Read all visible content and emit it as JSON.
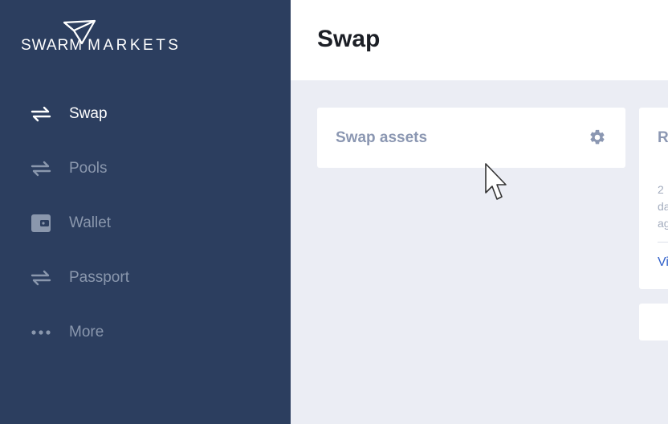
{
  "logo": {
    "word1": "SWARM",
    "word2": "MARKETS"
  },
  "nav": {
    "items": [
      {
        "label": "Swap",
        "icon": "swap-arrows-icon",
        "active": true
      },
      {
        "label": "Pools",
        "icon": "swap-arrows-icon",
        "active": false
      },
      {
        "label": "Wallet",
        "icon": "wallet-icon",
        "active": false
      },
      {
        "label": "Passport",
        "icon": "swap-arrows-icon",
        "active": false
      },
      {
        "label": "More",
        "icon": "more-dots-icon",
        "active": false
      }
    ]
  },
  "header": {
    "title": "Swap"
  },
  "swap_card": {
    "title": "Swap assets",
    "settings_icon": "gear-icon"
  },
  "right_card": {
    "title": "R",
    "line1": "2",
    "line2": "da",
    "line3": "ag",
    "link": "Vi"
  },
  "colors": {
    "sidebar": "#2c3e5f",
    "background": "#ebedf4",
    "nav_inactive": "#8a97ad",
    "card_title": "#8b97b2",
    "link": "#2f5fc9"
  }
}
